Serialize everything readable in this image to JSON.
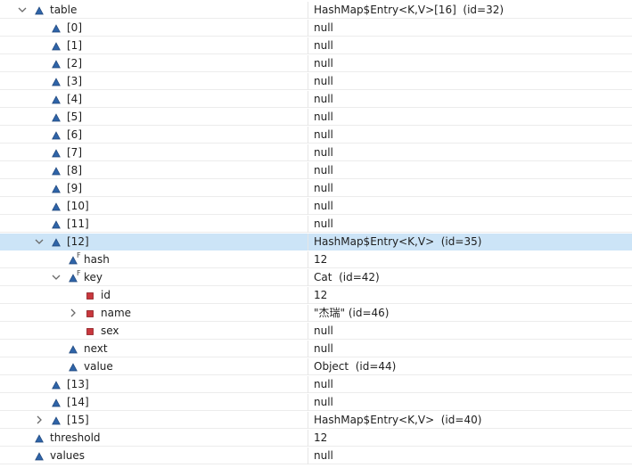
{
  "colors": {
    "selection": "#cce4f7",
    "field_icon": "#2f64a8",
    "private_icon": "#c8373d"
  },
  "rows": [
    {
      "depth": 1,
      "twisty": "expanded",
      "icon": "field",
      "final": false,
      "name": "table",
      "value": "HashMap$Entry<K,V>[16]  (id=32)"
    },
    {
      "depth": 2,
      "twisty": "none",
      "icon": "field",
      "final": false,
      "name": "[0]",
      "value": "null"
    },
    {
      "depth": 2,
      "twisty": "none",
      "icon": "field",
      "final": false,
      "name": "[1]",
      "value": "null"
    },
    {
      "depth": 2,
      "twisty": "none",
      "icon": "field",
      "final": false,
      "name": "[2]",
      "value": "null"
    },
    {
      "depth": 2,
      "twisty": "none",
      "icon": "field",
      "final": false,
      "name": "[3]",
      "value": "null"
    },
    {
      "depth": 2,
      "twisty": "none",
      "icon": "field",
      "final": false,
      "name": "[4]",
      "value": "null"
    },
    {
      "depth": 2,
      "twisty": "none",
      "icon": "field",
      "final": false,
      "name": "[5]",
      "value": "null"
    },
    {
      "depth": 2,
      "twisty": "none",
      "icon": "field",
      "final": false,
      "name": "[6]",
      "value": "null"
    },
    {
      "depth": 2,
      "twisty": "none",
      "icon": "field",
      "final": false,
      "name": "[7]",
      "value": "null"
    },
    {
      "depth": 2,
      "twisty": "none",
      "icon": "field",
      "final": false,
      "name": "[8]",
      "value": "null"
    },
    {
      "depth": 2,
      "twisty": "none",
      "icon": "field",
      "final": false,
      "name": "[9]",
      "value": "null"
    },
    {
      "depth": 2,
      "twisty": "none",
      "icon": "field",
      "final": false,
      "name": "[10]",
      "value": "null"
    },
    {
      "depth": 2,
      "twisty": "none",
      "icon": "field",
      "final": false,
      "name": "[11]",
      "value": "null"
    },
    {
      "depth": 2,
      "twisty": "expanded",
      "icon": "field",
      "final": false,
      "name": "[12]",
      "value": "HashMap$Entry<K,V>  (id=35)",
      "selected": true
    },
    {
      "depth": 3,
      "twisty": "none",
      "icon": "field",
      "final": true,
      "name": "hash",
      "value": "12"
    },
    {
      "depth": 3,
      "twisty": "expanded",
      "icon": "field",
      "final": true,
      "name": "key",
      "value": "Cat  (id=42)"
    },
    {
      "depth": 4,
      "twisty": "none",
      "icon": "private",
      "final": false,
      "name": "id",
      "value": "12"
    },
    {
      "depth": 4,
      "twisty": "collapsed",
      "icon": "private",
      "final": false,
      "name": "name",
      "value": "\"杰瑞\" (id=46)"
    },
    {
      "depth": 4,
      "twisty": "none",
      "icon": "private",
      "final": false,
      "name": "sex",
      "value": "null"
    },
    {
      "depth": 3,
      "twisty": "none",
      "icon": "field",
      "final": false,
      "name": "next",
      "value": "null"
    },
    {
      "depth": 3,
      "twisty": "none",
      "icon": "field",
      "final": false,
      "name": "value",
      "value": "Object  (id=44)"
    },
    {
      "depth": 2,
      "twisty": "none",
      "icon": "field",
      "final": false,
      "name": "[13]",
      "value": "null"
    },
    {
      "depth": 2,
      "twisty": "none",
      "icon": "field",
      "final": false,
      "name": "[14]",
      "value": "null"
    },
    {
      "depth": 2,
      "twisty": "collapsed",
      "icon": "field",
      "final": false,
      "name": "[15]",
      "value": "HashMap$Entry<K,V>  (id=40)"
    },
    {
      "depth": 1,
      "twisty": "none",
      "icon": "field",
      "final": false,
      "name": "threshold",
      "value": "12"
    },
    {
      "depth": 1,
      "twisty": "none",
      "icon": "field",
      "final": false,
      "name": "values",
      "value": "null"
    }
  ]
}
